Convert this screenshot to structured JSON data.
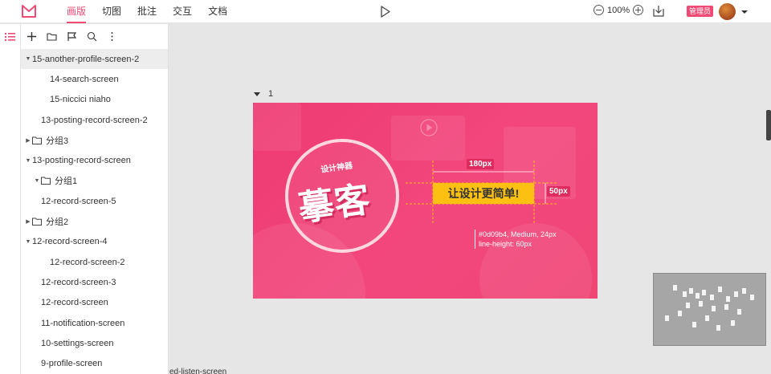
{
  "nav": {
    "tabs": [
      {
        "label": "画版",
        "active": true
      },
      {
        "label": "切图",
        "active": false
      },
      {
        "label": "批注",
        "active": false
      },
      {
        "label": "交互",
        "active": false
      },
      {
        "label": "文档",
        "active": false
      }
    ]
  },
  "toolbar": {
    "zoom_level": "100%",
    "admin_badge": "管理员"
  },
  "layers": [
    {
      "label": "15-another-profile-screen-2",
      "indent": 0,
      "caret": "down",
      "folder": false,
      "selected": true
    },
    {
      "label": "14-search-screen",
      "indent": 2,
      "caret": "",
      "folder": false,
      "selected": false
    },
    {
      "label": "15-niccici niaho",
      "indent": 2,
      "caret": "",
      "folder": false,
      "selected": false
    },
    {
      "label": "13-posting-record-screen-2",
      "indent": 1,
      "caret": "",
      "folder": false,
      "selected": false
    },
    {
      "label": "分组3",
      "indent": 0,
      "caret": "right",
      "folder": true,
      "selected": false
    },
    {
      "label": "13-posting-record-screen",
      "indent": 0,
      "caret": "down",
      "folder": false,
      "selected": false
    },
    {
      "label": "分组1",
      "indent": 1,
      "caret": "down",
      "folder": true,
      "selected": false
    },
    {
      "label": "12-record-screen-5",
      "indent": 1,
      "caret": "",
      "folder": false,
      "selected": false
    },
    {
      "label": "分组2",
      "indent": 0,
      "caret": "right",
      "folder": true,
      "selected": false
    },
    {
      "label": "12-record-screen-4",
      "indent": 0,
      "caret": "down",
      "folder": false,
      "selected": false
    },
    {
      "label": "12-record-screen-2",
      "indent": 2,
      "caret": "",
      "folder": false,
      "selected": false
    },
    {
      "label": "12-record-screen-3",
      "indent": 1,
      "caret": "",
      "folder": false,
      "selected": false
    },
    {
      "label": "12-record-screen",
      "indent": 1,
      "caret": "",
      "folder": false,
      "selected": false
    },
    {
      "label": "11-notification-screen",
      "indent": 1,
      "caret": "",
      "folder": false,
      "selected": false
    },
    {
      "label": "10-settings-screen",
      "indent": 1,
      "caret": "",
      "folder": false,
      "selected": false
    },
    {
      "label": "9-profile-screen",
      "indent": 1,
      "caret": "",
      "folder": false,
      "selected": false
    }
  ],
  "canvas": {
    "artboard_name": "1",
    "footer_partial": "ed-listen-screen",
    "banner": {
      "slogan_small": "设计神器",
      "slogan_big": "摹客",
      "cta": "让设计更简单!",
      "width_label": "180px",
      "height_label": "50px",
      "spec_line1": "#0d09b4, Medium, 24px",
      "spec_line2": "line-height: 60px"
    }
  },
  "colors": {
    "accent": "#f04a75",
    "cta": "#fcc013",
    "canvas_bg": "#e6e6e6"
  }
}
